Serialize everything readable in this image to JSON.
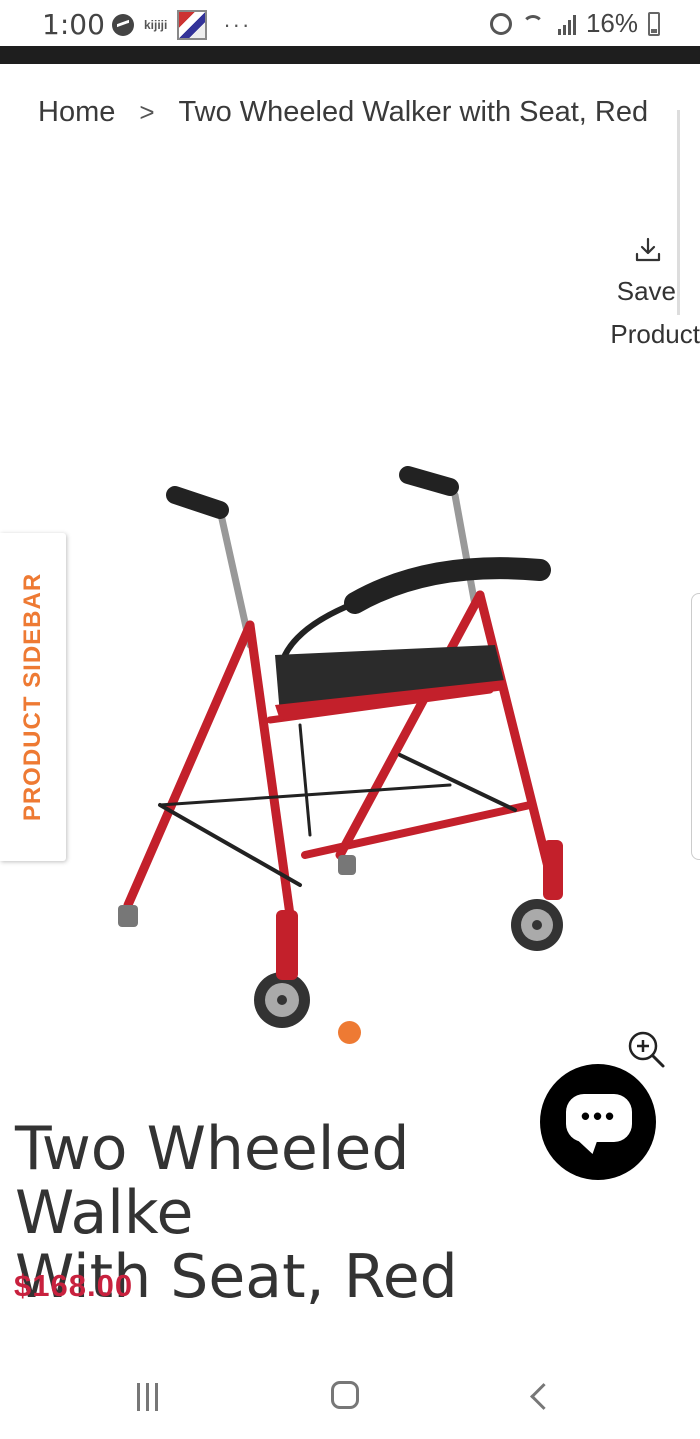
{
  "status_bar": {
    "time": "1:00",
    "app_label": "kijiji",
    "battery": "16%"
  },
  "breadcrumb": {
    "home": "Home",
    "separator": ">",
    "current": "Two Wheeled Walker with Seat, Red"
  },
  "save_product": {
    "line1": "Save",
    "line2": "Product"
  },
  "sidebar": {
    "label": "PRODUCT SIDEBAR"
  },
  "product": {
    "title_line1": "Two Wheeled Walke",
    "title_line2": "With Seat, Red",
    "price": "$168.00",
    "image_alt": "Two Wheeled Walker with Seat, Red",
    "carousel_active_index": 1,
    "carousel_count": 1
  },
  "chat": {
    "dots": "•••"
  },
  "colors": {
    "accent_orange": "#ee7a33",
    "price_red": "#c8213e",
    "frame_red": "#c3202b",
    "dark_bar": "#1e1e1e"
  },
  "icons": {
    "download": "download-icon",
    "zoom": "zoom-in-icon",
    "chat": "chat-bubble-icon"
  }
}
